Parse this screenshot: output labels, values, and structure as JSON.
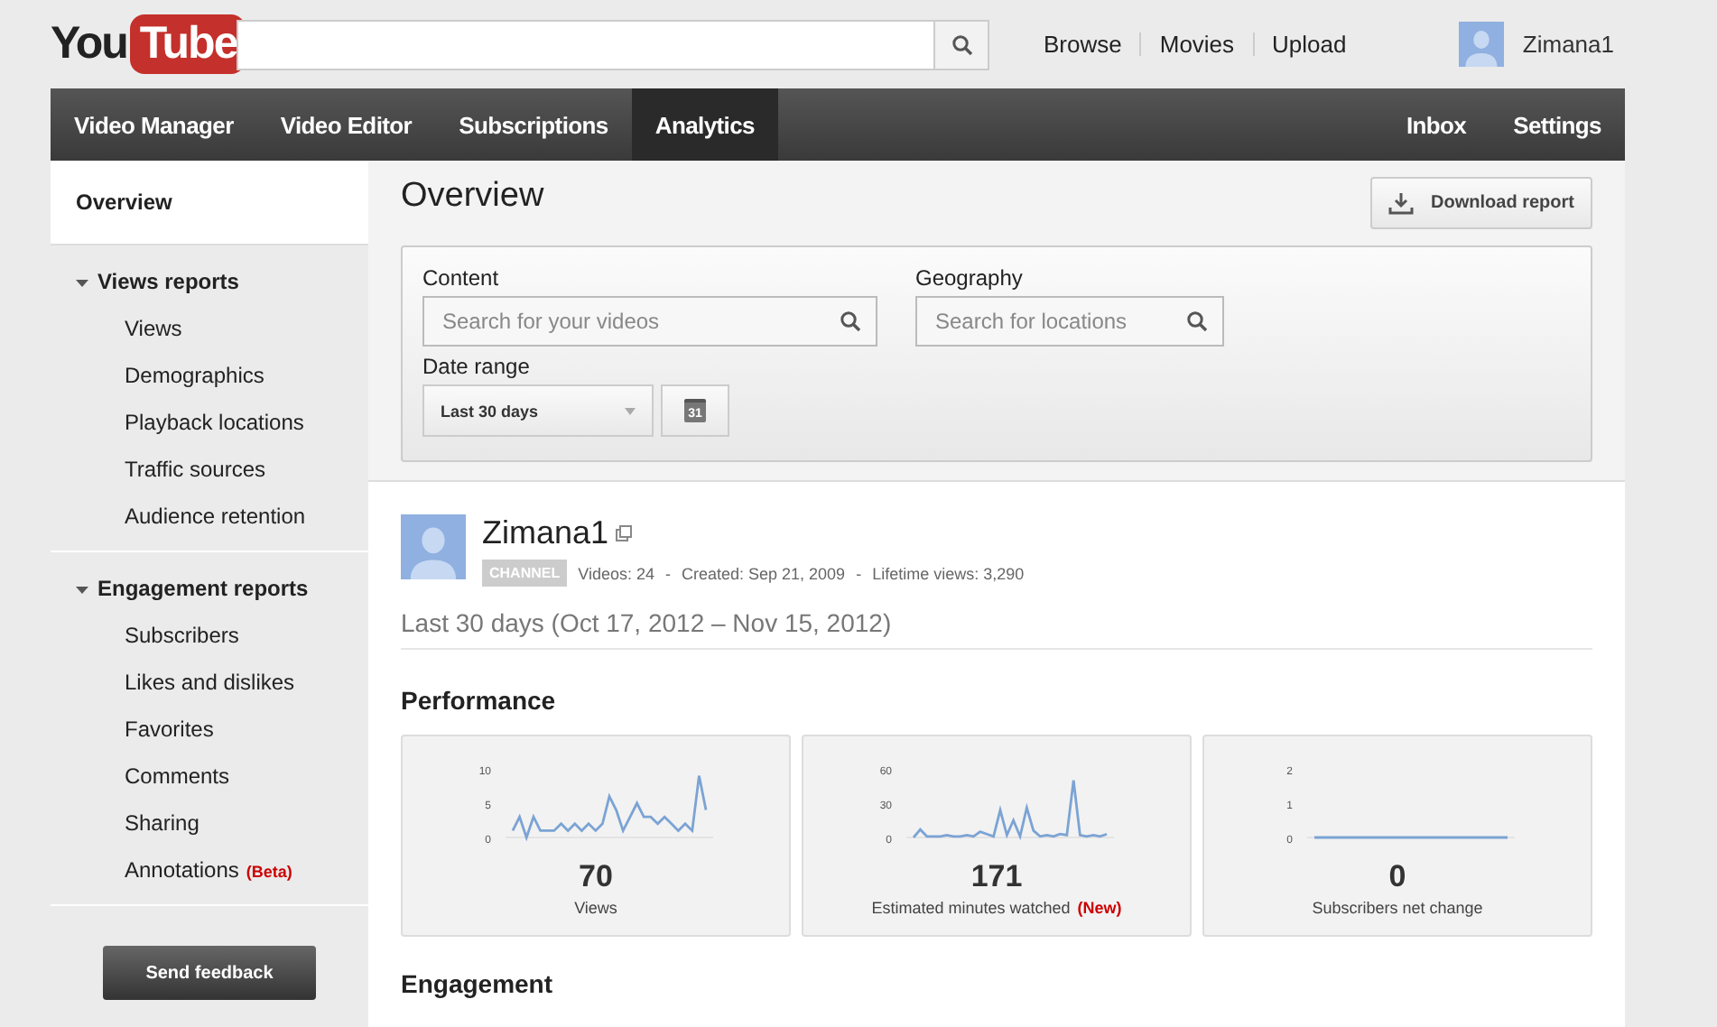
{
  "header": {
    "logo": {
      "you": "You",
      "tube": "Tube"
    },
    "links": [
      "Browse",
      "Movies",
      "Upload"
    ],
    "user": "Zimana1"
  },
  "nav": {
    "left": [
      {
        "label": "Video Manager",
        "selected": false
      },
      {
        "label": "Video Editor",
        "selected": false
      },
      {
        "label": "Subscriptions",
        "selected": false
      },
      {
        "label": "Analytics",
        "selected": true
      }
    ],
    "right": [
      {
        "label": "Inbox",
        "selected": false
      },
      {
        "label": "Settings",
        "selected": false
      }
    ]
  },
  "sidebar": {
    "overview": {
      "label": "Overview",
      "selected": true
    },
    "groups": [
      {
        "title": "Views reports",
        "expanded": true,
        "items": [
          {
            "label": "Views",
            "selected": false
          },
          {
            "label": "Demographics",
            "selected": false
          },
          {
            "label": "Playback locations",
            "selected": false
          },
          {
            "label": "Traffic sources",
            "selected": false
          },
          {
            "label": "Audience retention",
            "selected": false
          }
        ]
      },
      {
        "title": "Engagement reports",
        "expanded": true,
        "items": [
          {
            "label": "Subscribers",
            "selected": false
          },
          {
            "label": "Likes and dislikes",
            "selected": false
          },
          {
            "label": "Favorites",
            "selected": false
          },
          {
            "label": "Comments",
            "selected": false
          },
          {
            "label": "Sharing",
            "selected": false
          },
          {
            "label": "Annotations",
            "badge": "(Beta)",
            "selected": false
          }
        ]
      }
    ],
    "feedback": "Send feedback"
  },
  "main": {
    "title": "Overview",
    "download": "Download report",
    "filters": {
      "content_label": "Content",
      "content_placeholder": "Search for your videos",
      "geography_label": "Geography",
      "geography_placeholder": "Search for locations",
      "date_label": "Date range",
      "date_value": "Last 30 days",
      "calendar": "31"
    },
    "channel": {
      "name": "Zimana1",
      "badge": "CHANNEL",
      "stats": [
        "Videos: 24",
        "Created: Sep 21, 2009",
        "Lifetime views: 3,290"
      ],
      "separator": "-"
    },
    "period": "Last 30 days (Oct 17, 2012 – Nov 15, 2012)",
    "performance_title": "Performance",
    "cards": [
      {
        "value": "70",
        "label": "Views",
        "chart_data": {
          "type": "line",
          "ylim": [
            0,
            10
          ],
          "yticks": [
            0,
            5,
            10
          ],
          "series": [
            {
              "color": "#7ba3d4",
              "values": [
                1,
                3,
                0,
                3,
                1,
                1,
                1,
                2,
                1,
                2,
                1,
                2,
                1,
                2,
                6,
                4,
                1,
                3,
                5,
                3,
                3,
                2,
                3,
                2,
                1,
                2,
                1,
                9,
                4
              ]
            }
          ]
        }
      },
      {
        "value": "171",
        "label": "Estimated minutes watched",
        "badge": "(New)",
        "chart_data": {
          "type": "line",
          "ylim": [
            0,
            60
          ],
          "yticks": [
            0,
            30,
            60
          ],
          "series": [
            {
              "color": "#7ba3d4",
              "values": [
                0,
                7,
                1,
                1,
                1,
                2,
                1,
                1,
                2,
                1,
                5,
                3,
                1,
                24,
                2,
                15,
                1,
                26,
                6,
                1,
                2,
                1,
                3,
                2,
                50,
                2,
                1,
                2,
                1,
                3
              ]
            }
          ]
        }
      },
      {
        "value": "0",
        "label": "Subscribers net change",
        "chart_data": {
          "type": "line",
          "ylim": [
            0,
            2
          ],
          "yticks": [
            0,
            1,
            2
          ],
          "series": [
            {
              "color": "#7ba3d4",
              "values": [
                0,
                0,
                0,
                0,
                0,
                0,
                0,
                0,
                0,
                0,
                0,
                0,
                0,
                0,
                0,
                0,
                0,
                0,
                0,
                0,
                0,
                0,
                0,
                0,
                0,
                0,
                0,
                0,
                0,
                0
              ]
            }
          ]
        }
      }
    ],
    "engagement_title": "Engagement"
  }
}
